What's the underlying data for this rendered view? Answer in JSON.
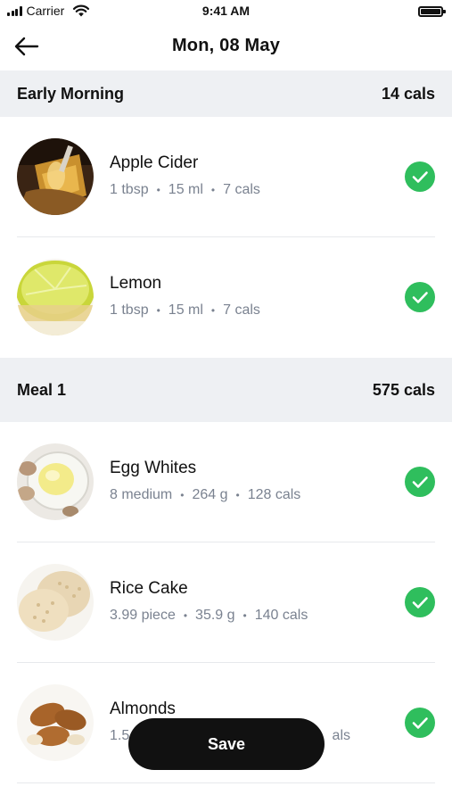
{
  "status_bar": {
    "carrier": "Carrier",
    "time": "9:41 AM"
  },
  "header": {
    "title": "Mon, 08 May",
    "back_icon": "arrow-left-icon"
  },
  "sections": [
    {
      "name": "Early Morning",
      "cals": "14 cals",
      "items": [
        {
          "name": "Apple Cider",
          "qty": "1 tbsp",
          "weight": "15 ml",
          "cals": "7 cals",
          "checked": true
        },
        {
          "name": "Lemon",
          "qty": "1 tbsp",
          "weight": "15 ml",
          "cals": "7 cals",
          "checked": true
        }
      ]
    },
    {
      "name": "Meal 1",
      "cals": "575 cals",
      "items": [
        {
          "name": "Egg Whites",
          "qty": "8 medium",
          "weight": "264 g",
          "cals": "128 cals",
          "checked": true
        },
        {
          "name": "Rice Cake",
          "qty": "3.99 piece",
          "weight": "35.9 g",
          "cals": "140 cals",
          "checked": true
        },
        {
          "name": "Almonds",
          "qty": "1.5",
          "weight": "",
          "cals": "als",
          "checked": true
        }
      ]
    }
  ],
  "save_label": "Save",
  "colors": {
    "check": "#2fbe5d",
    "section_bg": "#eef0f3",
    "meta": "#7a8290"
  }
}
